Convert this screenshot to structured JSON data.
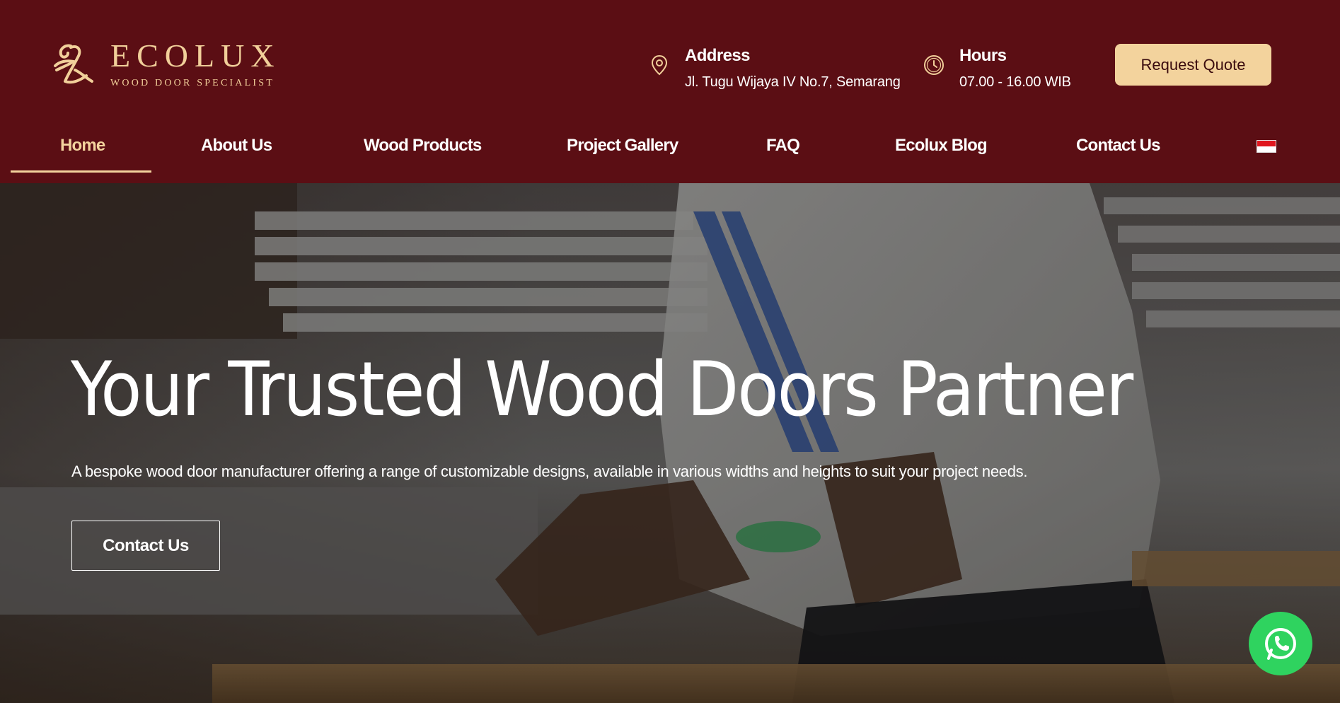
{
  "brand": {
    "name": "ECOLUX",
    "tagline": "WOOD DOOR SPECIALIST",
    "logo_icon": "ecolux-monogram-icon"
  },
  "header": {
    "address": {
      "icon": "location-pin-icon",
      "title": "Address",
      "value": "Jl. Tugu Wijaya IV No.7, Semarang"
    },
    "hours": {
      "icon": "clock-icon",
      "title": "Hours",
      "value": "07.00 - 16.00 WIB"
    },
    "cta_label": "Request Quote"
  },
  "nav": {
    "items": [
      {
        "label": "Home",
        "active": true
      },
      {
        "label": "About Us"
      },
      {
        "label": "Wood Products"
      },
      {
        "label": "Project Gallery"
      },
      {
        "label": "FAQ"
      },
      {
        "label": "Ecolux Blog"
      },
      {
        "label": "Contact Us"
      }
    ],
    "language_flag": "indonesia-flag-icon"
  },
  "hero": {
    "title": "Your Trusted Wood Doors Partner",
    "subtitle": "A bespoke wood door manufacturer offering a range of customizable designs, available in various widths and heights to suit your project needs.",
    "button_label": "Contact Us"
  },
  "floating": {
    "whatsapp_icon": "whatsapp-icon"
  },
  "colors": {
    "header_bg": "#5b0e14",
    "accent": "#f3d39d",
    "whatsapp": "#2fd35f"
  }
}
